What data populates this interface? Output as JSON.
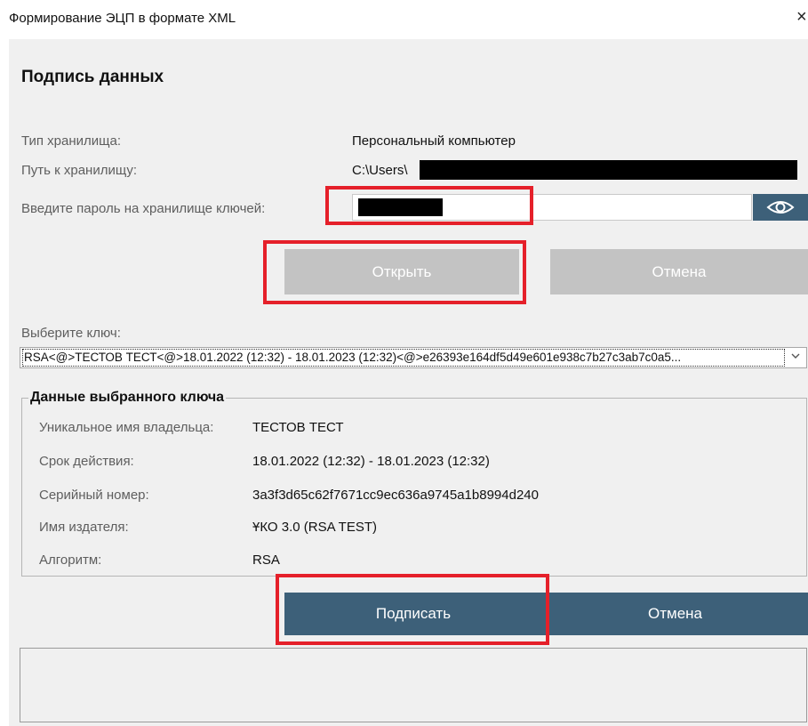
{
  "window": {
    "title": "Формирование ЭЦП в формате XML",
    "close_glyph": "×"
  },
  "section": {
    "title": "Подпись данных"
  },
  "storage": {
    "type_label": "Тип хранилища:",
    "type_value": "Персональный компьютер",
    "path_label": "Путь к хранилищу:",
    "path_value": "C:\\Users\\",
    "password_label": "Введите пароль на хранилище ключей:"
  },
  "buttons": {
    "open": "Открыть",
    "cancel_top": "Отмена",
    "sign": "Подписать",
    "cancel_bottom": "Отмена"
  },
  "key_select": {
    "label": "Выберите ключ:",
    "selected": "RSA<@>ТЕСТОВ ТЕСТ<@>18.01.2022 (12:32) - 18.01.2023 (12:32)<@>e26393e164df5d49e601e938c7b27c3ab7c0a5..."
  },
  "key_details": {
    "legend": "Данные выбранного ключа",
    "rows": [
      {
        "label": "Уникальное имя владельца:",
        "value": "ТЕСТОВ ТЕСТ"
      },
      {
        "label": "Срок действия:",
        "value": "18.01.2022 (12:32) - 18.01.2023 (12:32)"
      },
      {
        "label": "Серийный номер:",
        "value": "3a3f3d65c62f7671cc9ec636a9745a1b8994d240"
      },
      {
        "label": "Имя издателя:",
        "value": "ҰКО 3.0 (RSA TEST)"
      },
      {
        "label": "Алгоритм:",
        "value": "RSA"
      }
    ]
  },
  "icons": {
    "eye": "eye-icon",
    "close": "close-icon",
    "dropdown": "chevron-down-icon"
  },
  "colors": {
    "accent": "#3d6079",
    "disabled_button": "#c3c3c3",
    "highlight": "#e5202a",
    "redaction": "#000000"
  }
}
